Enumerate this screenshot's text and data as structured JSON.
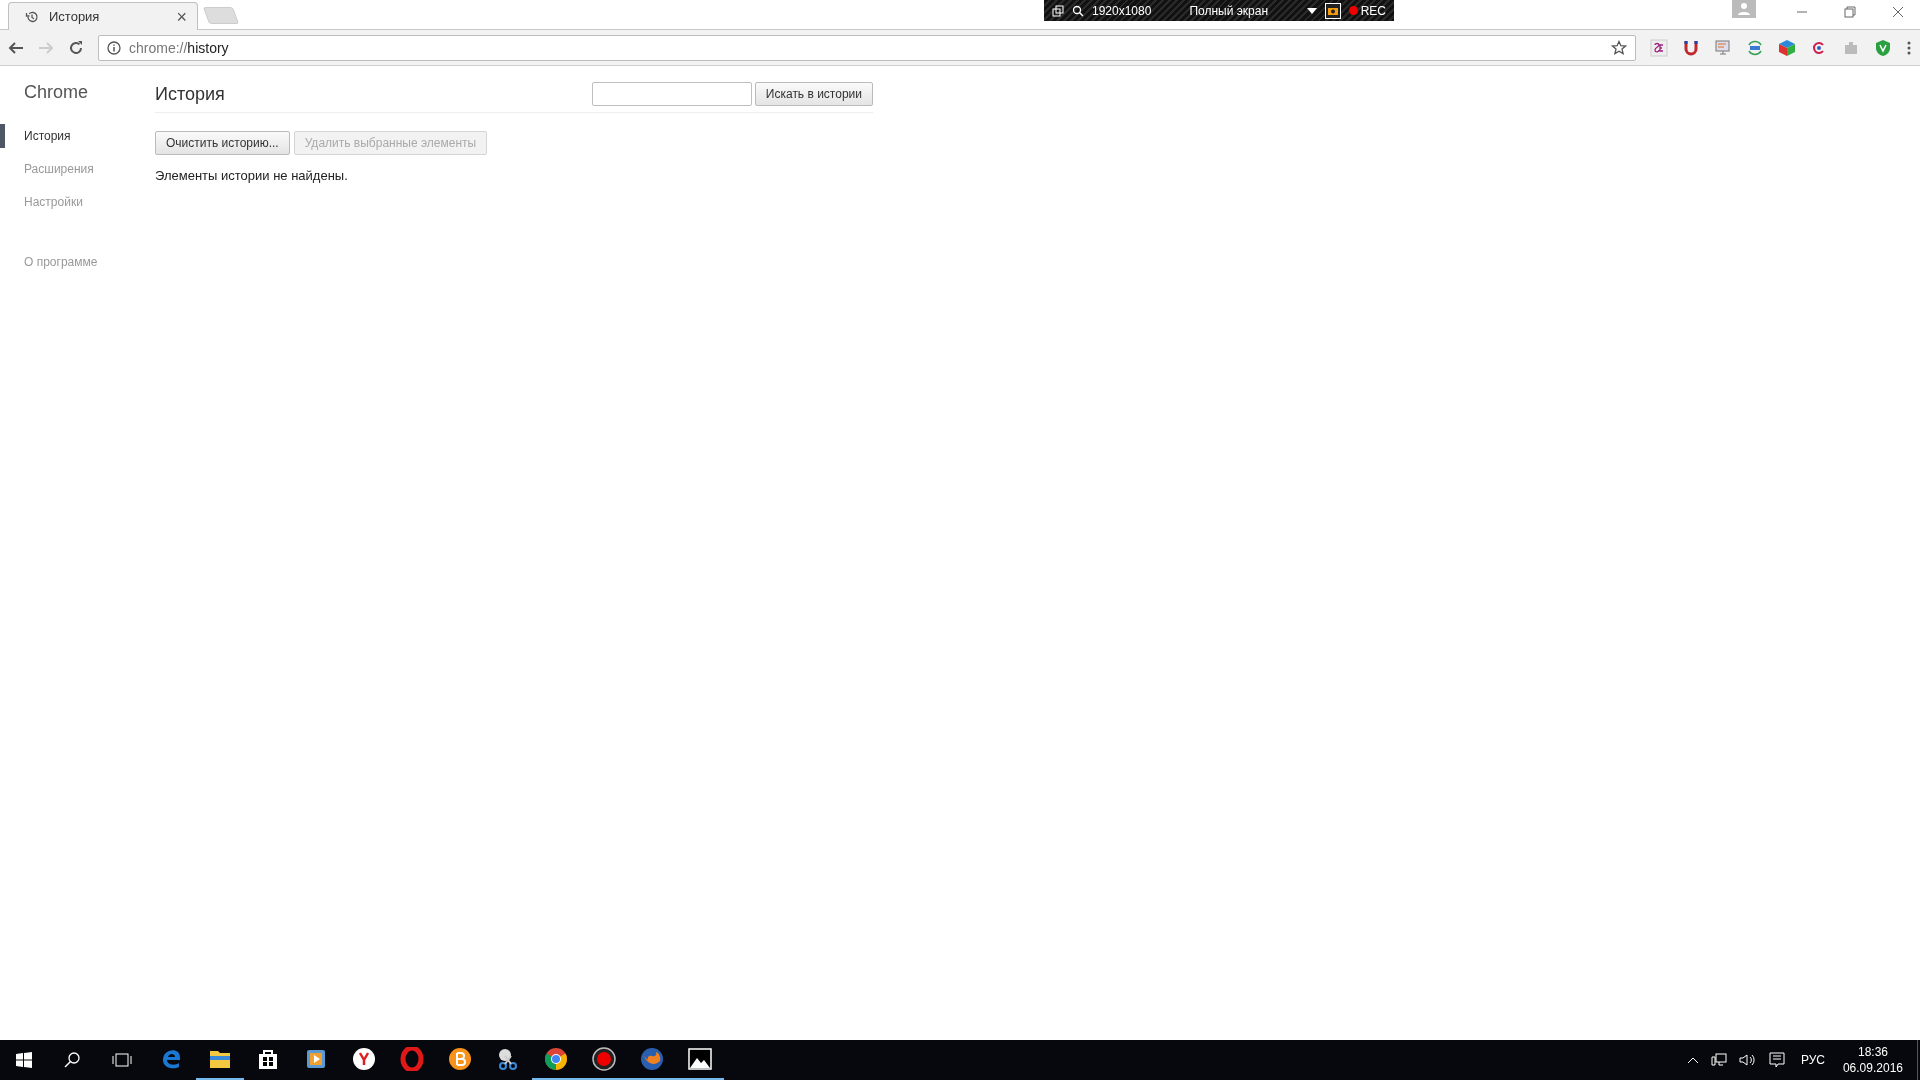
{
  "tabs": [
    {
      "title": "История",
      "close": "×",
      "selected": true
    }
  ],
  "address_bar": {
    "scheme": "chrome://",
    "path": "history"
  },
  "recorder_bar": {
    "resolution": "1920x1080",
    "mode": "Полный экран",
    "rec": "REC"
  },
  "sidebar": {
    "title": "Chrome",
    "items": [
      {
        "label": "История",
        "selected": true
      },
      {
        "label": "Расширения",
        "selected": false
      },
      {
        "label": "Настройки",
        "selected": false
      }
    ],
    "about": "О программе"
  },
  "page": {
    "title": "История",
    "search": {
      "button": "Искать в истории"
    },
    "buttons": [
      {
        "label": "Очистить историю...",
        "disabled": false
      },
      {
        "label": "Удалить выбранные элементы",
        "disabled": true
      }
    ],
    "message": "Элементы истории не найдены."
  },
  "taskbar": {
    "apps": [
      {
        "running": false
      },
      {
        "running": true
      },
      {
        "running": false
      },
      {
        "running": false
      },
      {
        "running": false
      },
      {
        "running": false
      },
      {
        "running": false
      },
      {
        "running": false
      },
      {
        "running": true
      },
      {
        "running": true
      },
      {
        "running": true
      },
      {
        "running": true
      }
    ],
    "language": "РУС",
    "time": "18:36",
    "date": "06.09.2016"
  }
}
